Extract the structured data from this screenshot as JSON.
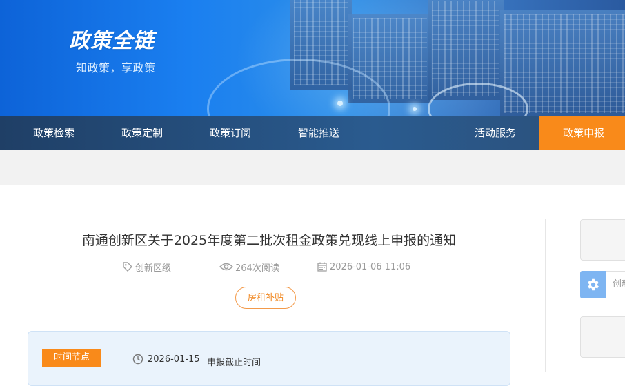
{
  "header": {
    "logo_text": "政策全链",
    "slogan": "知政策，享政策"
  },
  "nav": {
    "items": [
      {
        "label": "政策检索"
      },
      {
        "label": "政策定制"
      },
      {
        "label": "政策订阅"
      },
      {
        "label": "智能推送"
      },
      {
        "label": "活动服务"
      },
      {
        "label": "政策申报"
      }
    ],
    "active_index": 5,
    "active_color": "#f98a1a"
  },
  "article": {
    "title": "南通创新区关于2025年度第二批次租金政策兑现线上申报的通知",
    "level": "创新区级",
    "views": "264次阅读",
    "datetime": "2026-01-06 11:06",
    "tag": "房租补贴"
  },
  "timeline": {
    "badge": "时间节点",
    "date": "2026-01-15",
    "label": "申报截止时间"
  },
  "sidebar": {
    "search_placeholder": "创新"
  },
  "colors": {
    "accent": "#f98a1a",
    "banner_blue": "#1a7ff0",
    "nav_dark": "#1f3f66"
  }
}
